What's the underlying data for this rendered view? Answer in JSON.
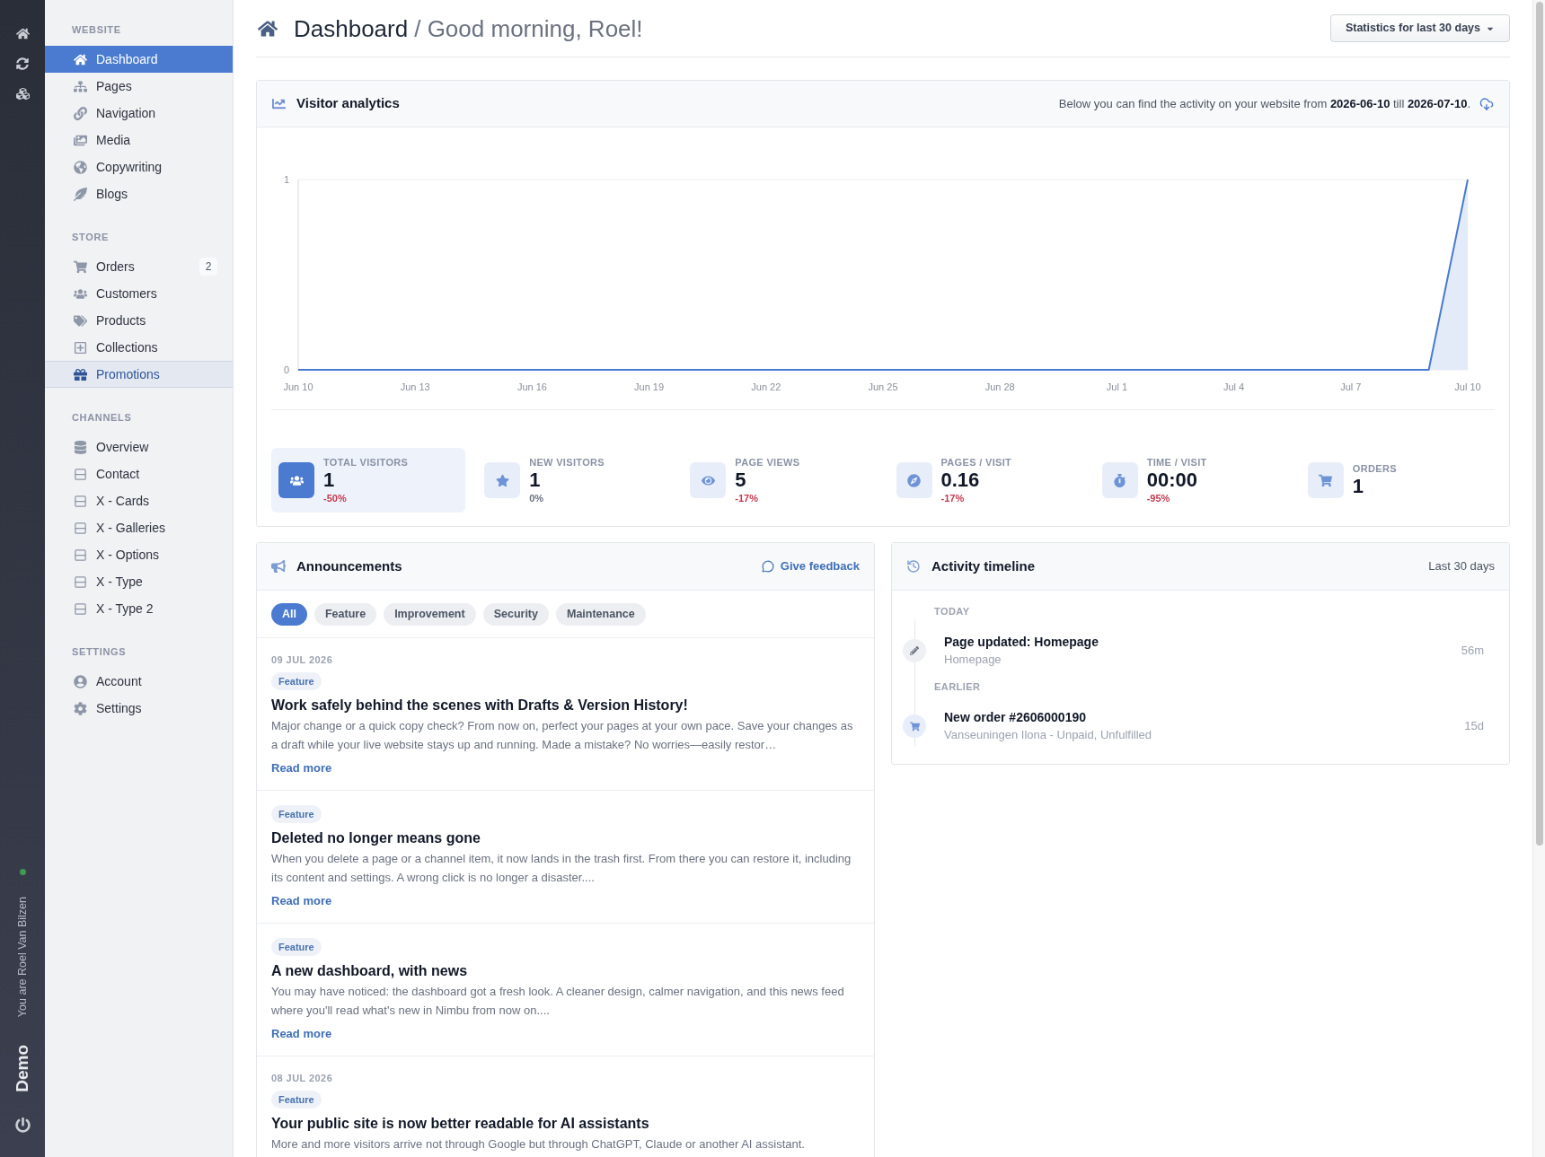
{
  "rail": {
    "online": true,
    "user_label": "You are Roel Van Bilzen",
    "brand": "Demo"
  },
  "sidebar": {
    "sections": [
      {
        "title": "WEBSITE",
        "items": [
          {
            "label": "Dashboard",
            "selected": true,
            "highlighted": false
          },
          {
            "label": "Pages",
            "selected": false,
            "highlighted": false
          },
          {
            "label": "Navigation",
            "selected": false,
            "highlighted": false
          },
          {
            "label": "Media",
            "selected": false,
            "highlighted": false
          },
          {
            "label": "Copywriting",
            "selected": false,
            "highlighted": false
          },
          {
            "label": "Blogs",
            "selected": false,
            "highlighted": false
          }
        ]
      },
      {
        "title": "STORE",
        "items": [
          {
            "label": "Orders",
            "badge": "2",
            "selected": false,
            "highlighted": false
          },
          {
            "label": "Customers",
            "selected": false,
            "highlighted": false
          },
          {
            "label": "Products",
            "selected": false,
            "highlighted": false
          },
          {
            "label": "Collections",
            "selected": false,
            "highlighted": false
          },
          {
            "label": "Promotions",
            "selected": false,
            "highlighted": true
          }
        ]
      },
      {
        "title": "CHANNELS",
        "items": [
          {
            "label": "Overview",
            "selected": false,
            "highlighted": false
          },
          {
            "label": "Contact",
            "selected": false,
            "highlighted": false
          },
          {
            "label": "X - Cards",
            "selected": false,
            "highlighted": false
          },
          {
            "label": "X - Galleries",
            "selected": false,
            "highlighted": false
          },
          {
            "label": "X - Options",
            "selected": false,
            "highlighted": false
          },
          {
            "label": "X - Type",
            "selected": false,
            "highlighted": false
          },
          {
            "label": "X - Type 2",
            "selected": false,
            "highlighted": false
          }
        ]
      },
      {
        "title": "SETTINGS",
        "items": [
          {
            "label": "Account",
            "selected": false,
            "highlighted": false
          },
          {
            "label": "Settings",
            "selected": false,
            "highlighted": false
          }
        ]
      }
    ]
  },
  "header": {
    "title": "Dashboard",
    "greeting": "/ Good morning, Roel!",
    "range_button": "Statistics for last 30 days"
  },
  "analytics": {
    "title": "Visitor analytics",
    "note": "Below you can find the activity on your website from **2026-06-10** till **2026-07-10**.",
    "chart_data": {
      "type": "area",
      "categories": [
        "Jun 10",
        null,
        null,
        "Jun 13",
        null,
        null,
        "Jun 16",
        null,
        null,
        "Jun 19",
        null,
        null,
        "Jun 22",
        null,
        null,
        "Jun 25",
        null,
        null,
        "Jun 28",
        null,
        null,
        "Jul 1",
        null,
        null,
        "Jul 4",
        null,
        null,
        "Jul 7",
        null,
        null,
        "Jul 10"
      ],
      "series": [
        {
          "color": "#4a7bd0",
          "values": [
            0,
            0,
            0,
            0,
            0,
            0,
            0,
            0,
            0,
            0,
            0,
            0,
            0,
            0,
            0,
            0,
            0,
            0,
            0,
            0,
            0,
            0,
            0,
            0,
            0,
            0,
            0,
            0,
            0,
            0,
            1
          ]
        }
      ],
      "ylim": [
        0,
        1
      ],
      "yticks": [
        0,
        1
      ]
    },
    "stats": [
      {
        "label": "TOTAL VISITORS",
        "value": "1",
        "change": "-50%",
        "negative": true,
        "selected": true
      },
      {
        "label": "NEW VISITORS",
        "value": "1",
        "change": "0%",
        "negative": false,
        "selected": false
      },
      {
        "label": "PAGE VIEWS",
        "value": "5",
        "change": "-17%",
        "negative": true,
        "selected": false
      },
      {
        "label": "PAGES / VISIT",
        "value": "0.16",
        "change": "-17%",
        "negative": true,
        "selected": false
      },
      {
        "label": "TIME / VISIT",
        "value": "00:00",
        "change": "-95%",
        "negative": true,
        "selected": false
      },
      {
        "label": "ORDERS",
        "value": "1",
        "selected": false
      }
    ]
  },
  "announcements": {
    "title": "Announcements",
    "feedback_link": "Give feedback",
    "filters": [
      {
        "label": "All",
        "selected": true
      },
      {
        "label": "Feature",
        "selected": false
      },
      {
        "label": "Improvement",
        "selected": false
      },
      {
        "label": "Security",
        "selected": false
      },
      {
        "label": "Maintenance",
        "selected": false
      }
    ],
    "posts": [
      {
        "date": "09 JUL 2026",
        "tag": "Feature",
        "title": "Work safely behind the scenes with Drafts & Version History!",
        "body": "Major change or a quick copy check? From now on, perfect your pages at your own pace. Save your changes as a draft while your live website stays up and running. Made a mistake? No worries—easily restor…",
        "link": "Read more"
      },
      {
        "tag": "Feature",
        "title": "Deleted no longer means gone",
        "body": "When you delete a page or a channel item, it now lands in the trash first. From there you can restore it, including its content and settings. A wrong click is no longer a disaster....",
        "link": "Read more"
      },
      {
        "tag": "Feature",
        "title": "A new dashboard, with news",
        "body": "You may have noticed: the dashboard got a fresh look. A cleaner design, calmer navigation, and this news feed where you'll read what's new in Nimbu from now on....",
        "link": "Read more"
      },
      {
        "date": "08 JUL 2026",
        "tag": "Feature",
        "title": "Your public site is now better readable for AI assistants",
        "body": "More and more visitors arrive not through Google but through ChatGPT, Claude or another AI assistant."
      }
    ]
  },
  "activity": {
    "title": "Activity timeline",
    "range": "Last 30 days",
    "groups": [
      {
        "label": "TODAY",
        "items": [
          {
            "kind": "page",
            "title": "Page updated: Homepage",
            "detail": "Homepage",
            "time": "56m"
          }
        ]
      },
      {
        "label": "EARLIER",
        "items": [
          {
            "kind": "order",
            "title": "New order #2606000190",
            "detail": "Vanseuningen Ilona - Unpaid, Unfulfilled",
            "time": "15d"
          }
        ]
      }
    ]
  }
}
